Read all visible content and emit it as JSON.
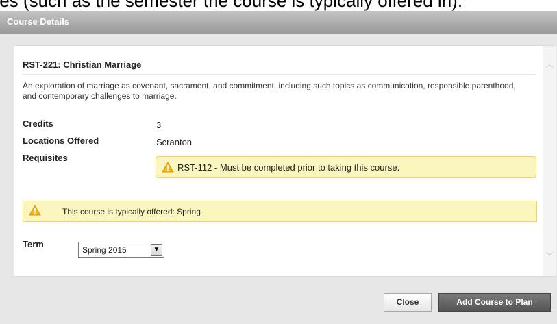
{
  "background_caption": "tes (such as the semester the course is typically offered in).",
  "dialog": {
    "title": "Course Details"
  },
  "course": {
    "title": "RST-221: Christian Marriage",
    "description": "An exploration of marriage as covenant, sacrament, and commitment, including such topics as communication, responsible parenthood, and contemporary challenges to marriage.",
    "credits_label": "Credits",
    "credits_value": "3",
    "locations_label": "Locations Offered",
    "locations_value": "Scranton",
    "requisites_label": "Requisites",
    "requisite_text": "RST-112 - Must be completed prior to taking this course."
  },
  "offered_notice": "This course is typically offered: Spring",
  "term": {
    "label": "Term",
    "selected": "Spring 2015"
  },
  "buttons": {
    "close": "Close",
    "add": "Add Course to Plan"
  },
  "icons": {
    "warning": "warning-triangle-icon",
    "dropdown": "chevron-down-icon",
    "scroll_up": "scroll-up-icon",
    "scroll_down": "scroll-down-icon"
  },
  "colors": {
    "notice_bg": "#fbf5be",
    "notice_border": "#f0d34f",
    "primary_button": "#555555",
    "titlebar": "#999999"
  }
}
